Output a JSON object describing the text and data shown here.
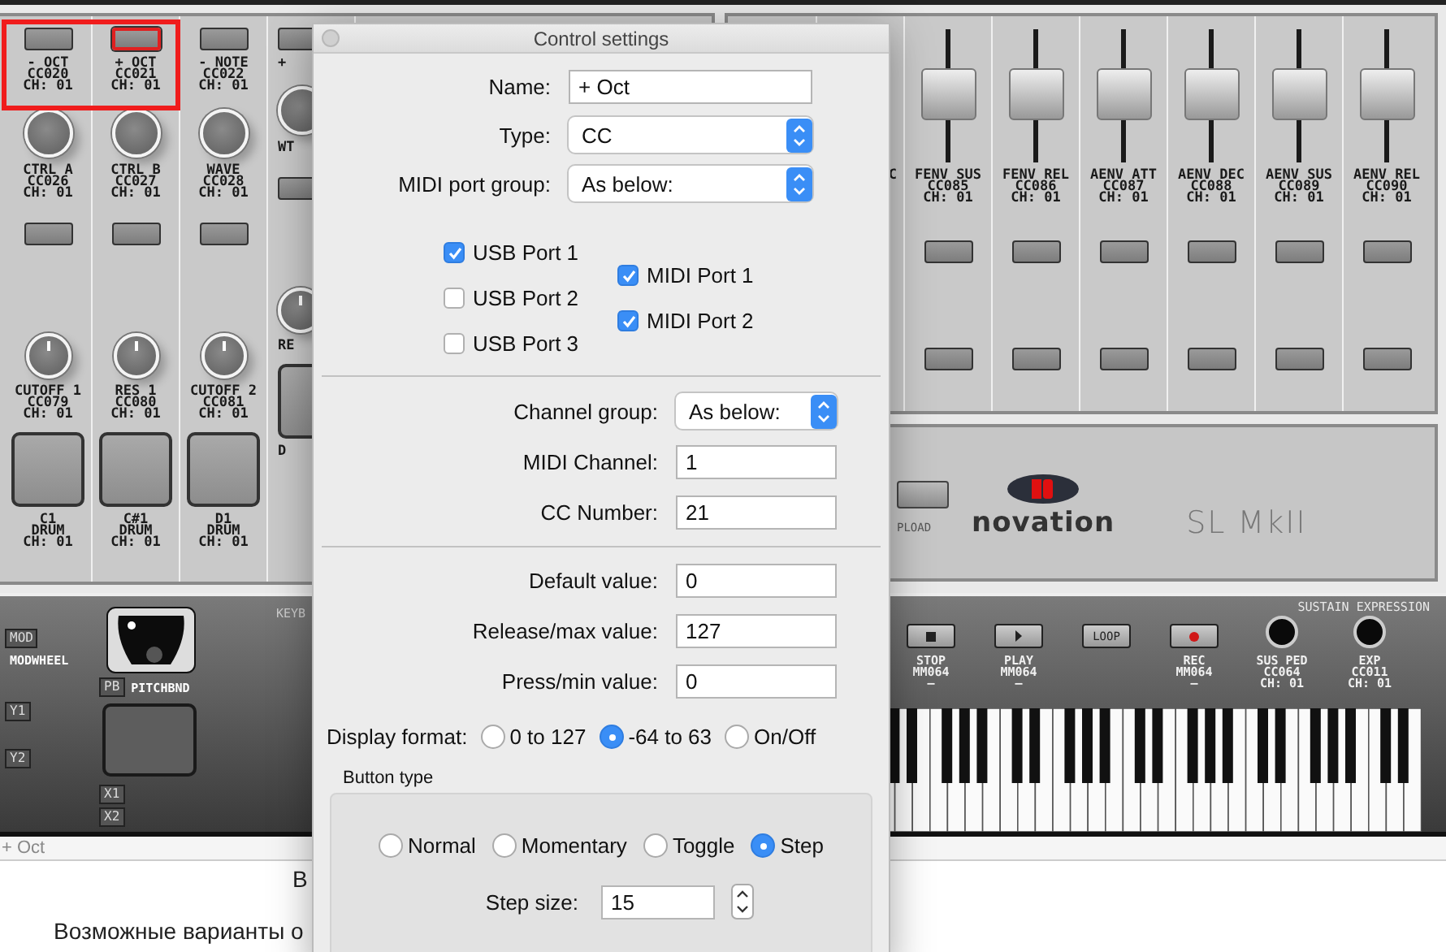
{
  "left_strips": [
    {
      "kind": "full",
      "highlighted": true,
      "top_button": {
        "selected": false,
        "lines": [
          "- OCT",
          "CC020",
          "CH: 01"
        ]
      },
      "knob": [
        "CTRL A",
        "CC026",
        "CH: 01"
      ],
      "pointer_knob": [
        "CUTOFF 1",
        "CC079",
        "CH: 01"
      ],
      "pad": [
        "C1",
        "DRUM",
        "CH: 01"
      ]
    },
    {
      "kind": "full",
      "highlighted": true,
      "top_button": {
        "selected": true,
        "lines": [
          "+ OCT",
          "CC021",
          "CH: 01"
        ]
      },
      "knob": [
        "CTRL B",
        "CC027",
        "CH: 01"
      ],
      "pointer_knob": [
        "RES 1",
        "CC080",
        "CH: 01"
      ],
      "pad": [
        "C#1",
        "DRUM",
        "CH: 01"
      ]
    },
    {
      "kind": "full",
      "highlighted": false,
      "top_button": {
        "selected": false,
        "lines": [
          "- NOTE",
          "CC022",
          "CH: 01"
        ]
      },
      "knob": [
        "WAVE",
        "CC028",
        "CH: 01"
      ],
      "pointer_knob": [
        "CUTOFF 2",
        "CC081",
        "CH: 01"
      ],
      "pad": [
        "D1",
        "DRUM",
        "CH: 01"
      ]
    },
    {
      "kind": "partial",
      "highlighted": false,
      "top_button": {
        "selected": false,
        "lines": [
          "+"
        ]
      },
      "knob": [
        "WT"
      ],
      "pointer_knob": [
        "RE"
      ],
      "pad": [
        "D"
      ]
    }
  ],
  "right_strips": [
    {
      "kind": "partial",
      "lines": [
        "C"
      ]
    },
    {
      "kind": "full",
      "lines": [
        "FENV SUS",
        "CC085",
        "CH: 01"
      ]
    },
    {
      "kind": "full",
      "lines": [
        "FENV REL",
        "CC086",
        "CH: 01"
      ]
    },
    {
      "kind": "full",
      "lines": [
        "AENV ATT",
        "CC087",
        "CH: 01"
      ]
    },
    {
      "kind": "full",
      "lines": [
        "AENV DEC",
        "CC088",
        "CH: 01"
      ]
    },
    {
      "kind": "full",
      "lines": [
        "AENV SUS",
        "CC089",
        "CH: 01"
      ]
    },
    {
      "kind": "full",
      "lines": [
        "AENV REL",
        "CC090",
        "CH: 01"
      ]
    }
  ],
  "logo_panel": {
    "upload_label": "PLOAD",
    "brand": "novation",
    "model": "SL MkII"
  },
  "controller_band": {
    "mod_label": "MOD",
    "modwheel_label": "MODWHEEL",
    "pb_label": "PB",
    "pitchbend_label": "PITCHBND",
    "y_labels": [
      "Y1",
      "Y2"
    ],
    "x_labels": [
      "X1",
      "X2"
    ],
    "keyboard_heading": "KEYB",
    "pedal_heading": "SUSTAIN EXPRESSION",
    "transport": [
      {
        "kind": "stop",
        "lines": [
          "STOP",
          "MM064",
          "–"
        ]
      },
      {
        "kind": "play",
        "lines": [
          "PLAY",
          "MM064",
          "–"
        ]
      },
      {
        "kind": "loop",
        "caption": "LOOP"
      },
      {
        "kind": "rec",
        "lines": [
          "REC",
          "MM064",
          "–"
        ]
      }
    ],
    "jacks": [
      {
        "lines": [
          "SUS PED",
          "CC064",
          "CH: 01"
        ]
      },
      {
        "lines": [
          "EXP",
          "CC011",
          "CH: 01"
        ]
      }
    ]
  },
  "status_bar": {
    "text": "+ Oct"
  },
  "page_texts": [
    "В",
    "Возможные варианты о"
  ],
  "dialog": {
    "title": "Control settings",
    "name": {
      "label": "Name:",
      "value": "+ Oct"
    },
    "type": {
      "label": "Type:",
      "value": "CC"
    },
    "port_group": {
      "label": "MIDI port group:",
      "value": "As below:"
    },
    "usb_ports": [
      {
        "label": "USB Port 1",
        "checked": true
      },
      {
        "label": "USB Port 2",
        "checked": false
      },
      {
        "label": "USB Port 3",
        "checked": false
      }
    ],
    "midi_ports": [
      {
        "label": "MIDI Port 1",
        "checked": true
      },
      {
        "label": "MIDI Port 2",
        "checked": true
      }
    ],
    "channel_group": {
      "label": "Channel group:",
      "value": "As below:"
    },
    "midi_channel": {
      "label": "MIDI Channel:",
      "value": "1"
    },
    "cc_number": {
      "label": "CC Number:",
      "value": "21"
    },
    "default_value": {
      "label": "Default value:",
      "value": "0"
    },
    "release_value": {
      "label": "Release/max value:",
      "value": "127"
    },
    "press_value": {
      "label": "Press/min value:",
      "value": "0"
    },
    "display_format": {
      "label": "Display format:",
      "options": [
        {
          "label": "0 to 127",
          "selected": false
        },
        {
          "label": "-64 to 63",
          "selected": true
        },
        {
          "label": "On/Off",
          "selected": false
        }
      ]
    },
    "button_type": {
      "title": "Button type",
      "options": [
        {
          "label": "Normal",
          "selected": false
        },
        {
          "label": "Momentary",
          "selected": false
        },
        {
          "label": "Toggle",
          "selected": false
        },
        {
          "label": "Step",
          "selected": true
        }
      ],
      "step_size": {
        "label": "Step size:",
        "value": "15"
      }
    }
  }
}
